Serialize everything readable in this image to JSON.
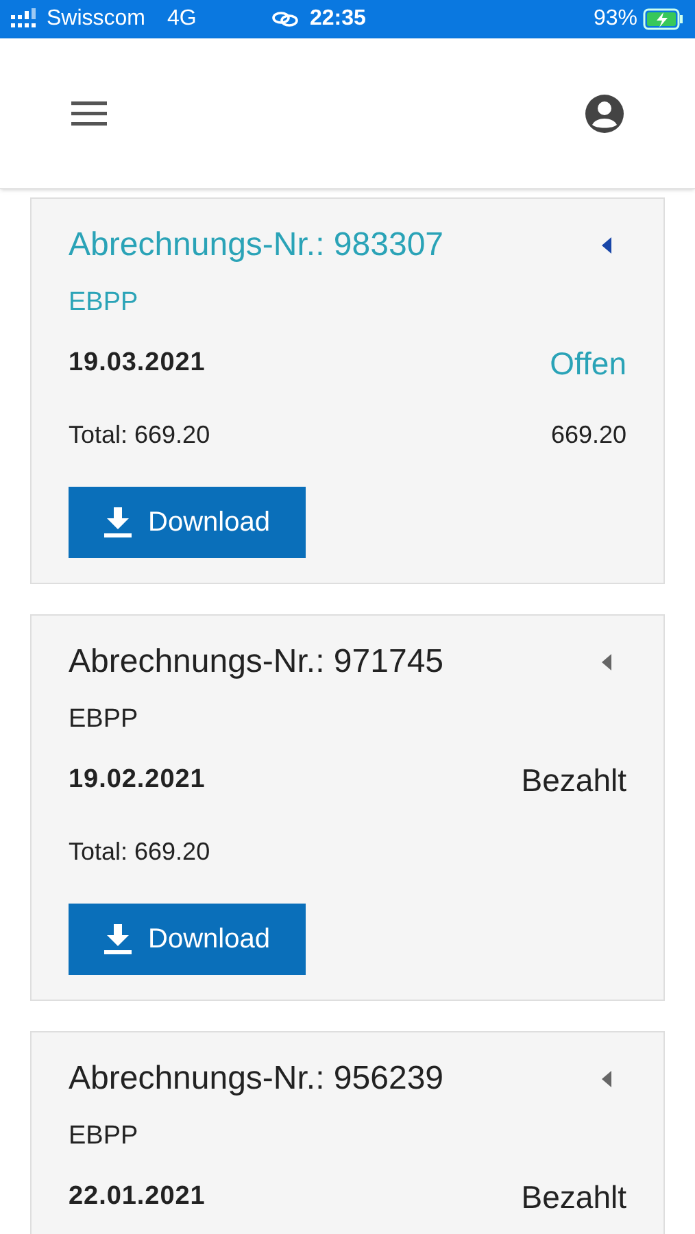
{
  "status_bar": {
    "carrier": "Swisscom",
    "network": "4G",
    "time": "22:35",
    "battery": "93%"
  },
  "invoices": [
    {
      "title": "Abrechnungs-Nr.: 983307",
      "type": "EBPP",
      "date": "19.03.2021",
      "status": "Offen",
      "open": true,
      "total": "Total: 669.20",
      "amount": "669.20",
      "button": "Download"
    },
    {
      "title": "Abrechnungs-Nr.: 971745",
      "type": "EBPP",
      "date": "19.02.2021",
      "status": "Bezahlt",
      "open": false,
      "total": "Total: 669.20",
      "button": "Download"
    },
    {
      "title": "Abrechnungs-Nr.: 956239",
      "type": "EBPP",
      "date": "22.01.2021",
      "status": "Bezahlt",
      "open": false
    }
  ]
}
